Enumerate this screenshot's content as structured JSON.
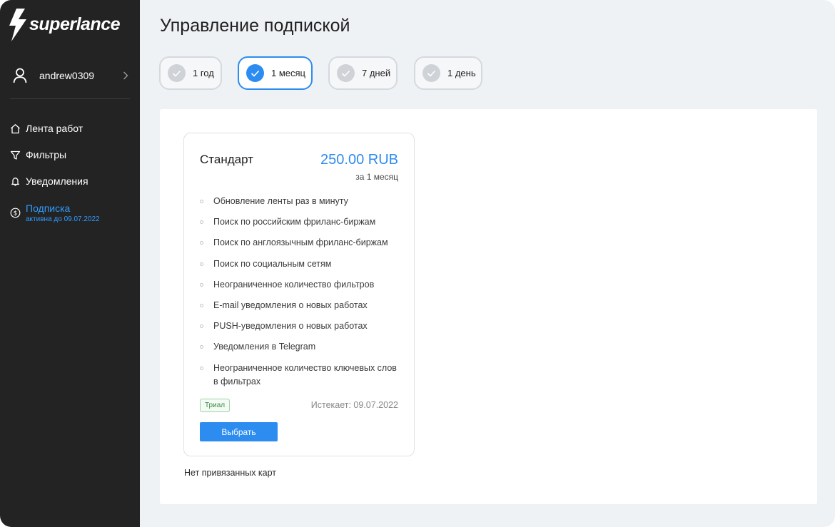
{
  "app": {
    "logo_text": "superlance"
  },
  "sidebar": {
    "user": {
      "name": "andrew0309"
    },
    "nav": [
      {
        "label": "Лента работ",
        "icon": "home-icon"
      },
      {
        "label": "Фильтры",
        "icon": "filter-icon"
      },
      {
        "label": "Уведомления",
        "icon": "bell-icon"
      },
      {
        "label": "Подписка",
        "sub": "активна до 09.07.2022",
        "icon": "dollar-circle-icon",
        "active": true
      }
    ]
  },
  "main": {
    "title": "Управление подпиской",
    "periods": [
      {
        "label": "1 год",
        "selected": false
      },
      {
        "label": "1 месяц",
        "selected": true
      },
      {
        "label": "7 дней",
        "selected": false
      },
      {
        "label": "1 день",
        "selected": false
      }
    ],
    "plan": {
      "name": "Стандарт",
      "price": "250.00 RUB",
      "period": "за 1 месяц",
      "features": [
        "Обновление ленты раз в минуту",
        "Поиск по российским фриланс-биржам",
        "Поиск по англоязычным фриланс-биржам",
        "Поиск по социальным сетям",
        "Неограниченное количество фильтров",
        "E-mail уведомления о новых работах",
        "PUSH-уведомления о новых работах",
        "Уведомления в Telegram",
        "Неограниченное количество ключевых слов в фильтрах"
      ],
      "badge": "Триал",
      "expires": "Истекает: 09.07.2022",
      "button": "Выбрать"
    },
    "no_cards": "Нет привязанных карт"
  },
  "colors": {
    "sidebar_bg": "#232323",
    "accent": "#2d8cf0",
    "page_bg": "#eff2f5"
  }
}
